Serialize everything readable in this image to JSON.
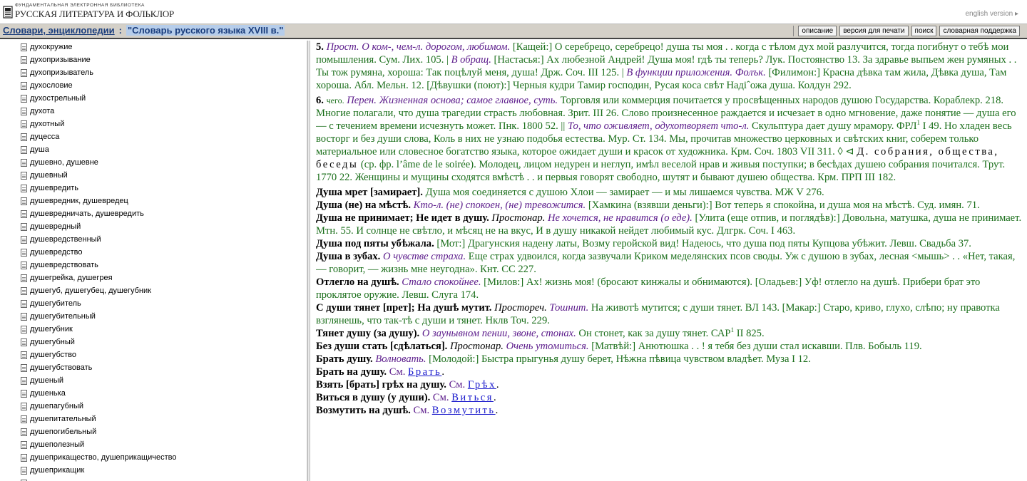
{
  "header": {
    "logo_line1": "ФУНДАМЕНТАЛЬНАЯ ЭЛЕКТРОННАЯ БИБЛИОТЕКА",
    "logo_line2": "РУССКАЯ ЛИТЕРАТУРА И ФОЛЬКЛОР",
    "english_link": "english version ▸"
  },
  "titlebar": {
    "crumb1": "Словари, энциклопедии",
    "separator": ":",
    "current": "\"Словарь русского языка XVIII в.\""
  },
  "toolbar": {
    "buttons": [
      "описание",
      "версия для печати",
      "поиск",
      "словарная поддержка"
    ]
  },
  "sidebar": {
    "items": [
      "духокружие",
      "духопризывание",
      "духопризыватель",
      "духословие",
      "духострельный",
      "духота",
      "духотный",
      "дуцесса",
      "душа",
      "душевно, душевне",
      "душевный",
      "душевредить",
      "душевредник, душевредец",
      "душевредничать, душевредить",
      "душевредный",
      "душевредственный",
      "душевредство",
      "душевредствовать",
      "душегрейка, душегрея",
      "душегуб, душегубец, душегубник",
      "душегубитель",
      "душегубительный",
      "душегубник",
      "душегубный",
      "душегубство",
      "душегубствовать",
      "душеный",
      "душенька",
      "душепагубный",
      "душепитательный",
      "душепогибельный",
      "душеполезный",
      "душеприкащество, душеприкащичество",
      "душеприкащик",
      "душеприкащичество"
    ]
  },
  "content": {
    "p1_num": "5.",
    "p1_label": "Прост.",
    "p1_def": "О ком-, чем-л. дорогом, любимом.",
    "p1_text_a": "[Кащей:] О серебрецо, серебрецо! душа ты моя . .  когда с тѣлом дух мой разлучится, тогда погибнут о тебѣ мои помышления. Сум. Лих. 105. |",
    "p1_obr": "В обращ.",
    "p1_text_b": "[Настасья:] Ах любезной Андрей! Душа моя! гдѣ ты теперь? Лук. Постоянство 13. За здравье выпьем жен румяных . .  Ты тож румяна, хороша: Так поцѣлуй меня, душа! Држ. Соч. III 125. |",
    "p1_pril": "В функции приложения. Фолък.",
    "p1_text_c": "[Филимон:] Красна дѣвка там жила, Дѣвка душа, Там хороша. Абл. Мельн. 12. [Дѣвушки (поют):] Черныя кудри Тамир господин, Русая коса свѣт Надіˆожа душа. Колдун 292.",
    "p2_num": "6.",
    "p2_chego": "чего.",
    "p2_label": "Перен. Жизненная основа; самое главное, суть.",
    "p2_text_a": "Торговля или коммерция почитается у просвѣщенных народов душою Государства. Кораблекр. 218. Многие полагали, что душа трагедии страсть любовная. Зрит. III 26. Слово произнесенное раждается и исчезает в одно мгновение, даже понятие — душа его — с течением времени исчезнуть может. Пнк. 1800 52. ||",
    "p2_label2": "То, что оживляет, одухотворяет что-л.",
    "p2_text_b1": "Скульптура дает душу мрамору. ФРЛ",
    "p2_sup": "1",
    "p2_text_b2": "I 49. Но хладен весь восторг и без души слова, Коль в них не узнаю подобья естества. Мур. Ст. 134. Мы, прочитав множество церковных и свѣтских книг, соберем только материальное или словесное богатство языка, которое ожидает души и красок от художника. Крм. Соч. 1803 VII 311. ◊ ⊲",
    "p2_spaced": "Д. собрания, общества, беседы",
    "p2_text_c": "(ср. фр. l’âme de le soirée). Молодец, лицом недурен и неглуп, имѣл веселой нрав и живыя поступки; в бесѣдах душею собрания почитался. Трут. 1770 22. Женщины и мущины сходятся вмѣстѣ . .  и первыя говорят свободно, шутят и бывают душею общества. Крм. ПРП III 182.",
    "ph1_b": "Душа мрет [замирает].",
    "ph1_t": "Душа моя соединяется с душою Хлои — замирает — и мы лишаемся чувства. МЖ V 276.",
    "ph2_b": "Душа (не) на мѣстѣ.",
    "ph2_i": "Кто-л. (не) спокоен, (не) тревожится.",
    "ph2_t": "[Хамкина (взявши деньги):] Вот теперь я спокойна, и душа моя на мѣстѣ. Суд. имян. 71.",
    "ph3_b": "Душа не принимает; Не идет в душу.",
    "ph3_i1": "Простонар.",
    "ph3_i2": "Не хочется, не нравится (о еде).",
    "ph3_t": "[Улита (еще отпив, и поглядѣв):] Довольна, матушка, душа не принимает. Мтн. 55. И солнце не свѣтло, и мѣсяц не на вкус, И в душу никакой нейдет любимый кус. Длгрк. Соч. I 463.",
    "ph4_b": "Душа под пяты убѣжала.",
    "ph4_t": "[Мот:] Драгунския надену латы, Возму геройской вид! Надеюсь, что душа под пяты Купцова убѣжит. Левш. Свадьба 37.",
    "ph5_b": "Душа в зубах.",
    "ph5_i": "О чувстве страха.",
    "ph5_t": "Еще страх удвоился, когда зазвучали Криком меделянских псов своды. Уж с душою в зубах, лесная <мышь> . .  «Нет, такая, — говорит, — жизнь мне неугодна». Кнт. СС 227.",
    "ph6_b": "Отлегло на душѣ.",
    "ph6_i": "Стало спокойнее.",
    "ph6_t": "[Милов:] Ах! жизнь моя! (бросают кинжалы и обнимаются). [Оладьев:] Уф! отлегло на душѣ. Прибери брат это проклятое оружие. Левш. Слуга 174.",
    "ph7_b": "С души тянет [прет]; На душѣ мутит.",
    "ph7_i1": "Простореч.",
    "ph7_i2": "Тошнит.",
    "ph7_t": "На животѣ мутится; с души тянет. ВЛ 143. [Макар:] Старо, криво, глухо, слѣпо; ну правотка взглянешь, что так-тѣ с души и тянет. Нклв Точ. 229.",
    "ph8_b": "Тянет душу (за душу).",
    "ph8_i": "О заунывном пении, звоне, стонах.",
    "ph8_t1": "Он стонет, как за душу тянет. САР",
    "ph8_sup": "1",
    "ph8_t2": "II 825.",
    "ph9_b": "Без души стать [сдѣлаться].",
    "ph9_i1": "Простонар.",
    "ph9_i2": "Очень утомиться.",
    "ph9_t": "[Матвѣй:] Анютюшка . . ! я тебя без души стал искавши. Плв. Бобыль 119.",
    "ph10_b": "Брать душу.",
    "ph10_i": "Волновать.",
    "ph10_t": "[Молодой:] Быстра прыгунья душу берет, Нѣжна пѣвица чувством владѣет. Муза I 12.",
    "ph11_b": "Брать на душу.",
    "ph11_see": "См.",
    "ph11_link": "Брать",
    "ph12_b": "Взять [брать] грѣх на душу.",
    "ph12_see": "См.",
    "ph12_link": "Грѣх",
    "ph13_b": "Виться в душу (у души).",
    "ph13_see": "См.",
    "ph13_link": "Виться",
    "ph14_b": "Возмутить на душѣ.",
    "ph14_see": "См.",
    "ph14_link": "Возмутить"
  }
}
